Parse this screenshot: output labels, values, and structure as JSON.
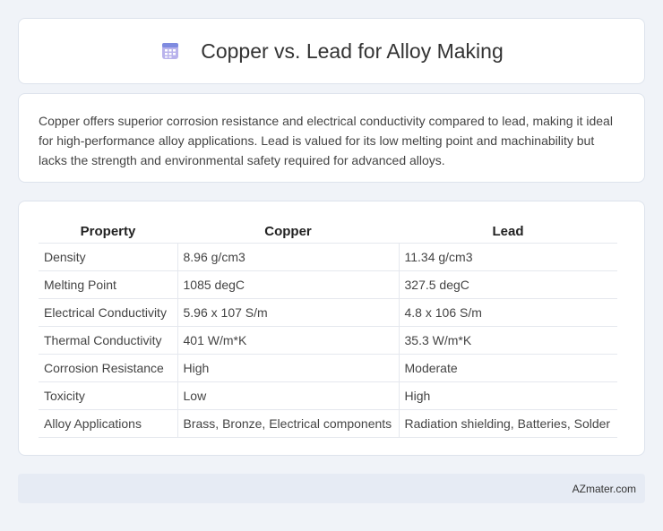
{
  "header": {
    "title": "Copper vs. Lead for Alloy Making",
    "icon": "calendar-icon"
  },
  "intro": {
    "text": "Copper offers superior corrosion resistance and electrical conductivity compared to lead, making it ideal for high-performance alloy applications. Lead is valued for its low melting point and machinability but lacks the strength and environmental safety required for advanced alloys."
  },
  "table": {
    "headers": [
      "Property",
      "Copper",
      "Lead"
    ],
    "rows": [
      [
        "Density",
        "8.96 g/cm3",
        "11.34 g/cm3"
      ],
      [
        "Melting Point",
        "1085 degC",
        "327.5 degC"
      ],
      [
        "Electrical Conductivity",
        "5.96 x 107 S/m",
        "4.8 x 106 S/m"
      ],
      [
        "Thermal Conductivity",
        "401 W/m*K",
        "35.3 W/m*K"
      ],
      [
        "Corrosion Resistance",
        "High",
        "Moderate"
      ],
      [
        "Toxicity",
        "Low",
        "High"
      ],
      [
        "Alloy Applications",
        "Brass, Bronze, Electrical components",
        "Radiation shielding, Batteries, Solder"
      ]
    ]
  },
  "footer": {
    "text": "AZmater.com"
  }
}
